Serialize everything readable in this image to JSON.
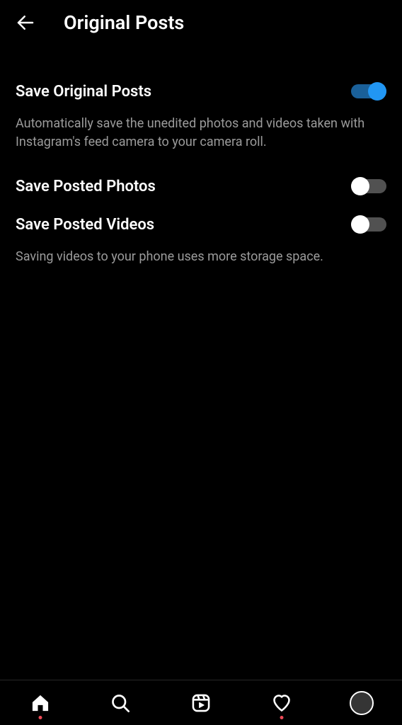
{
  "header": {
    "title": "Original Posts"
  },
  "settings": {
    "saveOriginal": {
      "label": "Save Original Posts",
      "description": "Automatically save the unedited photos and videos taken with Instagram's feed camera to your camera roll.",
      "enabled": true
    },
    "savePhotos": {
      "label": "Save Posted Photos",
      "enabled": false
    },
    "saveVideos": {
      "label": "Save Posted Videos",
      "description": "Saving videos to your phone uses more storage space.",
      "enabled": false
    }
  },
  "nav": {
    "home": {
      "notification": true
    },
    "search": {
      "notification": false
    },
    "reels": {
      "notification": false
    },
    "activity": {
      "notification": true
    },
    "profile": {
      "notification": false
    }
  }
}
